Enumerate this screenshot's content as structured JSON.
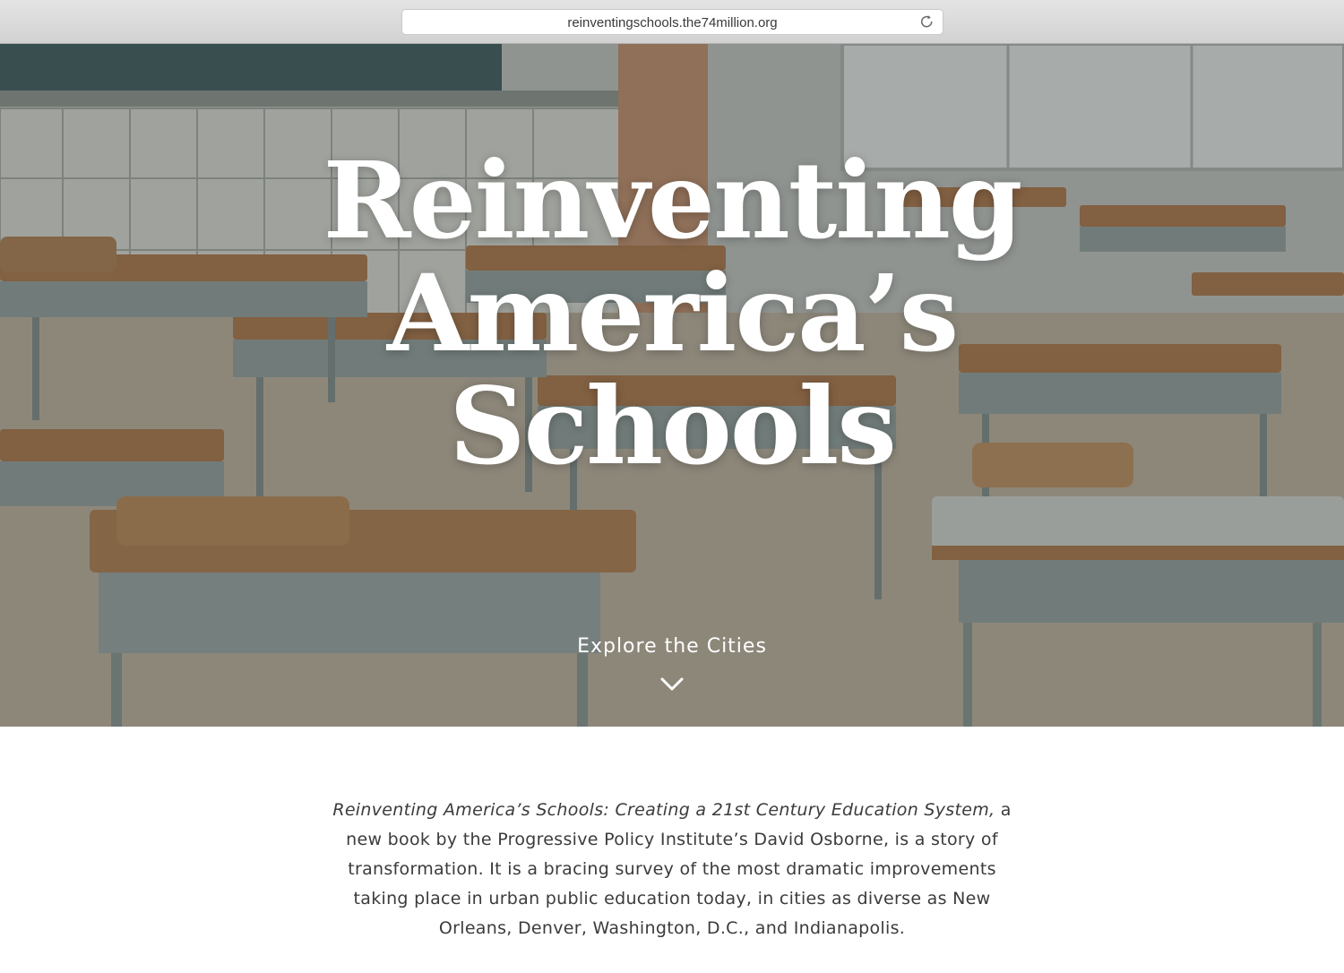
{
  "browser": {
    "url": "reinventingschools.the74million.org"
  },
  "hero": {
    "title_lines": [
      "Reinventing",
      "America’s",
      "Schools"
    ],
    "explore_label": "Explore the Cities"
  },
  "intro": {
    "book_title": "Reinventing America’s Schools: Creating a 21st Century Education System,",
    "text": " a new book by the Progressive Policy Institute’s David Osborne, is a story of transformation. It is a bracing survey of the most dramatic improvements taking place in urban public education today, in cities as diverse as New Orleans, Denver, Washington, D.C., and Indianapolis."
  },
  "colors": {
    "chrome": "#d8d8d8",
    "desk_top": "#a5744a",
    "desk_metal": "#8e9a98",
    "text_dark": "#3b3b3b"
  }
}
